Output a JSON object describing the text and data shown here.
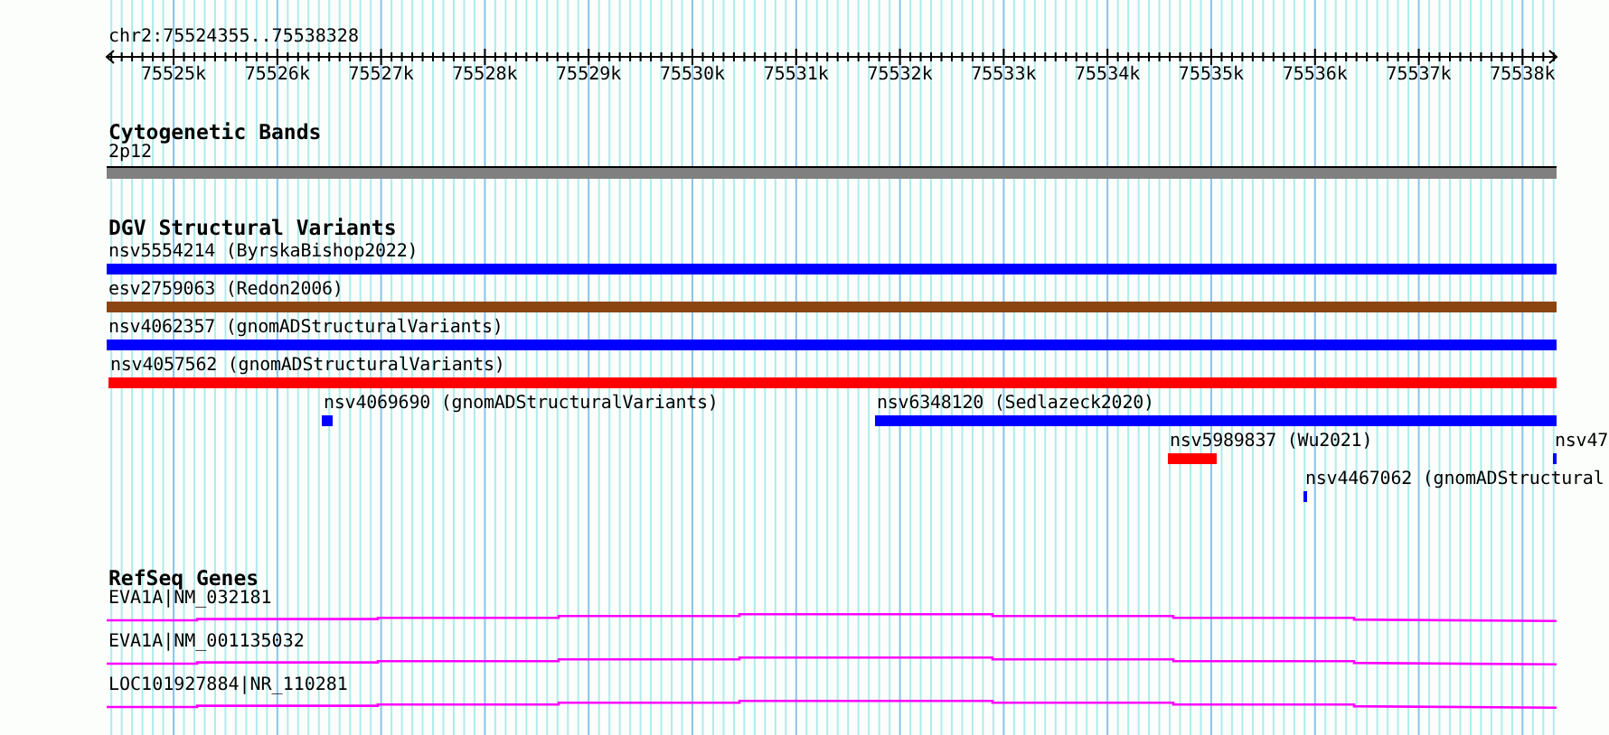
{
  "region": "chr2:75524355..75538328",
  "ruler": {
    "ticks": [
      "75525k",
      "75526k",
      "75527k",
      "75528k",
      "75529k",
      "75530k",
      "75531k",
      "75532k",
      "75533k",
      "75534k",
      "75535k",
      "75536k",
      "75537k",
      "75538k"
    ]
  },
  "tracks": [
    {
      "kind": "bands",
      "title": "Cytogenetic Bands",
      "label": "2p12"
    },
    {
      "kind": "variants",
      "title": "DGV Structural Variants",
      "lanes": [
        {
          "features": [
            {
              "label": "nsv5554214 (ByrskaBishop2022)",
              "color": "#0000ff"
            }
          ]
        },
        {
          "features": [
            {
              "label": "esv2759063 (Redon2006)",
              "color": "#8b4513"
            }
          ]
        },
        {
          "features": [
            {
              "label": "nsv4062357 (gnomADStructuralVariants)",
              "color": "#0000ff"
            }
          ]
        },
        {
          "features": [
            {
              "label": "nsv4057562 (gnomADStructuralVariants)",
              "color": "#ff0000"
            }
          ]
        },
        {
          "features": [
            {
              "label": "nsv4069690 (gnomADStructuralVariants)",
              "color": "#0000ff"
            },
            {
              "label": "nsv6348120 (Sedlazeck2020)",
              "color": "#0000ff"
            }
          ]
        },
        {
          "features": [
            {
              "label": "nsv5989837 (Wu2021)",
              "color": "#ff0000"
            },
            {
              "label": "nsv47",
              "color": "#0000ff"
            }
          ]
        },
        {
          "features": [
            {
              "label": "nsv4467062 (gnomADStructural",
              "color": "#0000ff"
            }
          ]
        }
      ]
    },
    {
      "kind": "genes",
      "title": "RefSeq Genes",
      "genes": [
        {
          "label": "EVA1A|NM_032181"
        },
        {
          "label": "EVA1A|NM_001135032"
        },
        {
          "label": "LOC101927884|NR_110281"
        }
      ]
    }
  ]
}
